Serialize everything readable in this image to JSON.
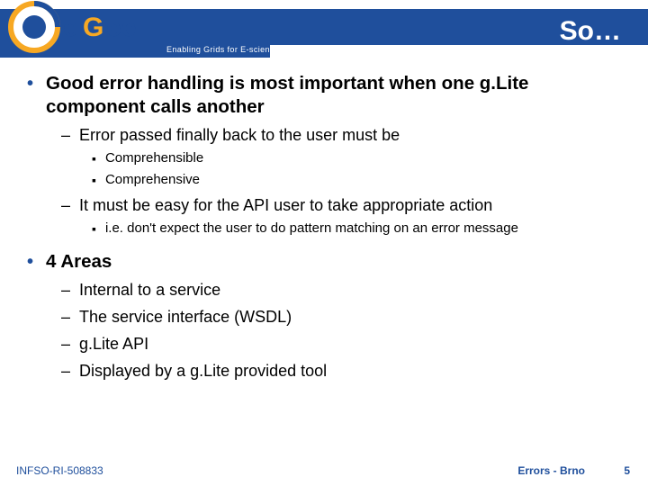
{
  "header": {
    "title": "So…",
    "tagline": "Enabling Grids for E-sciencE",
    "logo_alt": "egee"
  },
  "bullets": [
    {
      "text": "Good error handling is most important when one g.Lite component calls another",
      "children": [
        {
          "text": "Error passed finally back to the user must be",
          "children": [
            {
              "text": "Comprehensible"
            },
            {
              "text": "Comprehensive"
            }
          ]
        },
        {
          "text": "It must be easy for the API user to take appropriate action",
          "children": [
            {
              "text": "i.e. don't expect the user to do pattern matching on an error message"
            }
          ]
        }
      ]
    },
    {
      "text": "4 Areas",
      "children": [
        {
          "text": "Internal to a service"
        },
        {
          "text": "The service interface (WSDL)"
        },
        {
          "text": "g.Lite API"
        },
        {
          "text": "Displayed by a g.Lite provided tool"
        }
      ]
    }
  ],
  "footer": {
    "left": "INFSO-RI-508833",
    "right": "Errors - Brno",
    "page": "5"
  }
}
